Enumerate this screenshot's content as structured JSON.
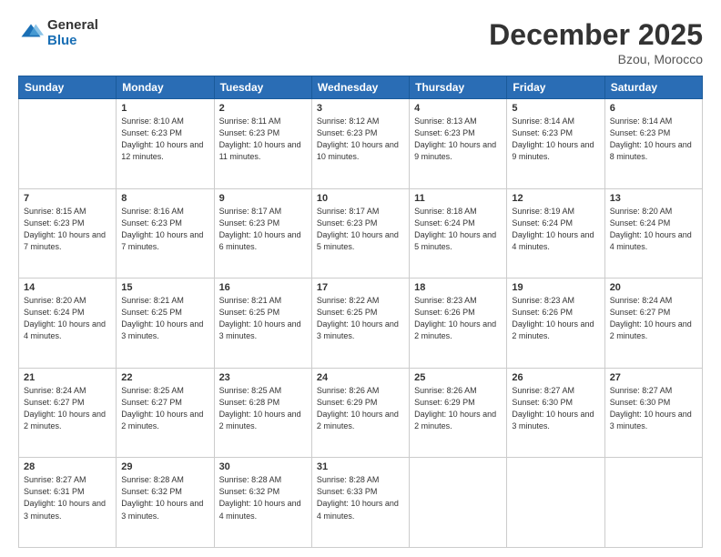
{
  "logo": {
    "general": "General",
    "blue": "Blue"
  },
  "header": {
    "month": "December 2025",
    "location": "Bzou, Morocco"
  },
  "days_of_week": [
    "Sunday",
    "Monday",
    "Tuesday",
    "Wednesday",
    "Thursday",
    "Friday",
    "Saturday"
  ],
  "weeks": [
    [
      {
        "day": "",
        "sunrise": "",
        "sunset": "",
        "daylight": ""
      },
      {
        "day": "1",
        "sunrise": "Sunrise: 8:10 AM",
        "sunset": "Sunset: 6:23 PM",
        "daylight": "Daylight: 10 hours and 12 minutes."
      },
      {
        "day": "2",
        "sunrise": "Sunrise: 8:11 AM",
        "sunset": "Sunset: 6:23 PM",
        "daylight": "Daylight: 10 hours and 11 minutes."
      },
      {
        "day": "3",
        "sunrise": "Sunrise: 8:12 AM",
        "sunset": "Sunset: 6:23 PM",
        "daylight": "Daylight: 10 hours and 10 minutes."
      },
      {
        "day": "4",
        "sunrise": "Sunrise: 8:13 AM",
        "sunset": "Sunset: 6:23 PM",
        "daylight": "Daylight: 10 hours and 9 minutes."
      },
      {
        "day": "5",
        "sunrise": "Sunrise: 8:14 AM",
        "sunset": "Sunset: 6:23 PM",
        "daylight": "Daylight: 10 hours and 9 minutes."
      },
      {
        "day": "6",
        "sunrise": "Sunrise: 8:14 AM",
        "sunset": "Sunset: 6:23 PM",
        "daylight": "Daylight: 10 hours and 8 minutes."
      }
    ],
    [
      {
        "day": "7",
        "sunrise": "Sunrise: 8:15 AM",
        "sunset": "Sunset: 6:23 PM",
        "daylight": "Daylight: 10 hours and 7 minutes."
      },
      {
        "day": "8",
        "sunrise": "Sunrise: 8:16 AM",
        "sunset": "Sunset: 6:23 PM",
        "daylight": "Daylight: 10 hours and 7 minutes."
      },
      {
        "day": "9",
        "sunrise": "Sunrise: 8:17 AM",
        "sunset": "Sunset: 6:23 PM",
        "daylight": "Daylight: 10 hours and 6 minutes."
      },
      {
        "day": "10",
        "sunrise": "Sunrise: 8:17 AM",
        "sunset": "Sunset: 6:23 PM",
        "daylight": "Daylight: 10 hours and 5 minutes."
      },
      {
        "day": "11",
        "sunrise": "Sunrise: 8:18 AM",
        "sunset": "Sunset: 6:24 PM",
        "daylight": "Daylight: 10 hours and 5 minutes."
      },
      {
        "day": "12",
        "sunrise": "Sunrise: 8:19 AM",
        "sunset": "Sunset: 6:24 PM",
        "daylight": "Daylight: 10 hours and 4 minutes."
      },
      {
        "day": "13",
        "sunrise": "Sunrise: 8:20 AM",
        "sunset": "Sunset: 6:24 PM",
        "daylight": "Daylight: 10 hours and 4 minutes."
      }
    ],
    [
      {
        "day": "14",
        "sunrise": "Sunrise: 8:20 AM",
        "sunset": "Sunset: 6:24 PM",
        "daylight": "Daylight: 10 hours and 4 minutes."
      },
      {
        "day": "15",
        "sunrise": "Sunrise: 8:21 AM",
        "sunset": "Sunset: 6:25 PM",
        "daylight": "Daylight: 10 hours and 3 minutes."
      },
      {
        "day": "16",
        "sunrise": "Sunrise: 8:21 AM",
        "sunset": "Sunset: 6:25 PM",
        "daylight": "Daylight: 10 hours and 3 minutes."
      },
      {
        "day": "17",
        "sunrise": "Sunrise: 8:22 AM",
        "sunset": "Sunset: 6:25 PM",
        "daylight": "Daylight: 10 hours and 3 minutes."
      },
      {
        "day": "18",
        "sunrise": "Sunrise: 8:23 AM",
        "sunset": "Sunset: 6:26 PM",
        "daylight": "Daylight: 10 hours and 2 minutes."
      },
      {
        "day": "19",
        "sunrise": "Sunrise: 8:23 AM",
        "sunset": "Sunset: 6:26 PM",
        "daylight": "Daylight: 10 hours and 2 minutes."
      },
      {
        "day": "20",
        "sunrise": "Sunrise: 8:24 AM",
        "sunset": "Sunset: 6:27 PM",
        "daylight": "Daylight: 10 hours and 2 minutes."
      }
    ],
    [
      {
        "day": "21",
        "sunrise": "Sunrise: 8:24 AM",
        "sunset": "Sunset: 6:27 PM",
        "daylight": "Daylight: 10 hours and 2 minutes."
      },
      {
        "day": "22",
        "sunrise": "Sunrise: 8:25 AM",
        "sunset": "Sunset: 6:27 PM",
        "daylight": "Daylight: 10 hours and 2 minutes."
      },
      {
        "day": "23",
        "sunrise": "Sunrise: 8:25 AM",
        "sunset": "Sunset: 6:28 PM",
        "daylight": "Daylight: 10 hours and 2 minutes."
      },
      {
        "day": "24",
        "sunrise": "Sunrise: 8:26 AM",
        "sunset": "Sunset: 6:29 PM",
        "daylight": "Daylight: 10 hours and 2 minutes."
      },
      {
        "day": "25",
        "sunrise": "Sunrise: 8:26 AM",
        "sunset": "Sunset: 6:29 PM",
        "daylight": "Daylight: 10 hours and 2 minutes."
      },
      {
        "day": "26",
        "sunrise": "Sunrise: 8:27 AM",
        "sunset": "Sunset: 6:30 PM",
        "daylight": "Daylight: 10 hours and 3 minutes."
      },
      {
        "day": "27",
        "sunrise": "Sunrise: 8:27 AM",
        "sunset": "Sunset: 6:30 PM",
        "daylight": "Daylight: 10 hours and 3 minutes."
      }
    ],
    [
      {
        "day": "28",
        "sunrise": "Sunrise: 8:27 AM",
        "sunset": "Sunset: 6:31 PM",
        "daylight": "Daylight: 10 hours and 3 minutes."
      },
      {
        "day": "29",
        "sunrise": "Sunrise: 8:28 AM",
        "sunset": "Sunset: 6:32 PM",
        "daylight": "Daylight: 10 hours and 3 minutes."
      },
      {
        "day": "30",
        "sunrise": "Sunrise: 8:28 AM",
        "sunset": "Sunset: 6:32 PM",
        "daylight": "Daylight: 10 hours and 4 minutes."
      },
      {
        "day": "31",
        "sunrise": "Sunrise: 8:28 AM",
        "sunset": "Sunset: 6:33 PM",
        "daylight": "Daylight: 10 hours and 4 minutes."
      },
      {
        "day": "",
        "sunrise": "",
        "sunset": "",
        "daylight": ""
      },
      {
        "day": "",
        "sunrise": "",
        "sunset": "",
        "daylight": ""
      },
      {
        "day": "",
        "sunrise": "",
        "sunset": "",
        "daylight": ""
      }
    ]
  ]
}
